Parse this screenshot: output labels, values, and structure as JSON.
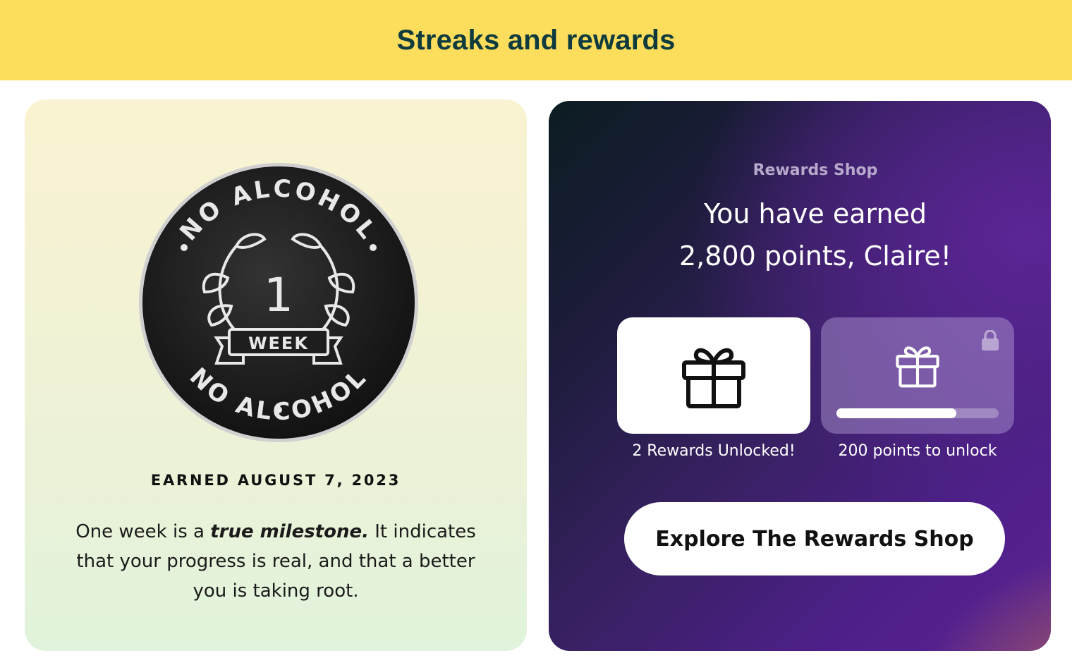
{
  "header": {
    "title": "Streaks and rewards"
  },
  "badge": {
    "ring_text_top": "NO ALCOHOL",
    "ring_text_right": "NO ALCOHOL",
    "ring_text_left": "NO ALCOHOL",
    "ring_text_bottom": "NO ALCOHOL",
    "number": "1",
    "ribbon": "WEEK"
  },
  "milestone": {
    "earned": "EARNED AUGUST 7, 2023",
    "desc_prefix": "One week is a ",
    "desc_emphasis": "true milestone.",
    "desc_suffix": " It indicates that your progress is real, and that a better you is taking root."
  },
  "rewards": {
    "label": "Rewards Shop",
    "line1": "You have earned",
    "line2": "2,800 points, Claire!",
    "unlocked_caption": "2 Rewards Unlocked!",
    "locked_caption": "200 points to unlock",
    "locked_progress": 0.74,
    "cta_label": "Explore The Rewards Shop"
  },
  "icons": {
    "gift": "gift-icon",
    "lock": "lock-icon",
    "laurel": "laurel-icon"
  },
  "colors": {
    "header_bg": "#fddd5c",
    "header_text": "#0f3b3e",
    "badge_bg": "#1e1e1e",
    "badge_fg": "#e8e8e8",
    "accent_purple": "#4f1f8c"
  }
}
